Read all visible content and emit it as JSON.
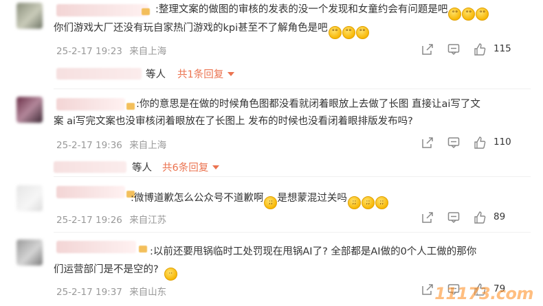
{
  "comments": [
    {
      "text": ":整理文案的做图的审核的发表的没一个发现和女童约会有问题是吧",
      "text2": "你们游戏大厂还没有玩自家热门游戏的kpi甚至不了解角色是吧",
      "time": "25-2-17 19:23",
      "location": "来自上海",
      "likes": "115",
      "reply": {
        "who": "等人",
        "link": "共1条回复"
      }
    },
    {
      "text": ":你的意思是在做的时候角色图都没看就闭着眼放上去做了长图 直接让ai写了文",
      "text2": "案 ai写完文案也没审核闭着眼放在了长图上 发布的时候也没看闭着眼排版发布吗?",
      "time": "25-2-17 19:36",
      "location": "来自上海",
      "likes": "110",
      "reply": {
        "who": "等人",
        "link": "共6条回复"
      }
    },
    {
      "text": ":微博道歉怎么公众号不道歉啊",
      "text_b": "是想蒙混过关吗",
      "time": "25-2-17 19:26",
      "location": "来自江苏",
      "likes": "89"
    },
    {
      "text": ":以前还要甩锅临时工处罚现在甩锅AI了? 全部都是AI做的0个人工做的那你",
      "text2": "们运营部门是不是空的?",
      "time": "25-2-17 19:37",
      "location": "来自山东",
      "likes": "79"
    }
  ],
  "icons": {
    "share": "share-icon",
    "comment": "comment-icon",
    "like": "thumbs-up-icon",
    "emoji": "emoji-face-icon"
  },
  "colors": {
    "accent": "#eb7350",
    "meta": "#999999",
    "text": "#333333"
  },
  "watermark": "11173.com"
}
